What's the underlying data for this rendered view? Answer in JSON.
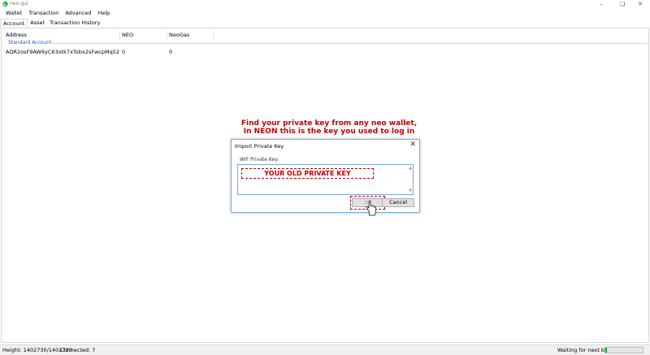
{
  "window": {
    "title": "neo-gui",
    "icon": "neo-logo-icon",
    "controls": [
      "minimize-icon",
      "maximize-icon",
      "close-icon"
    ]
  },
  "menu": [
    "Wallet",
    "Transaction",
    "Advanced",
    "Help"
  ],
  "tabs": [
    {
      "label": "Account",
      "active": true
    },
    {
      "label": "Asset",
      "active": false
    },
    {
      "label": "Transaction History",
      "active": false
    }
  ],
  "table": {
    "columns": [
      "Address",
      "NEO",
      "NeoGas"
    ],
    "group": "Standard Account",
    "rows": [
      {
        "address": "AQR2osF9AW6yC63otk7xTobx2sFwcpMq52",
        "neo": "0",
        "neogas": "0"
      }
    ]
  },
  "annotation": {
    "line1": "Find your private key from any neo wallet,",
    "line2": "In NEON this is the key you used to log in",
    "color": "#c00000"
  },
  "dialog": {
    "title": "Import Private Key",
    "field_label": "WIF Private Key:",
    "field_value": "YOUR OLD PRIVATE KEY",
    "ok_label": "OK",
    "cancel_label": "Cancel"
  },
  "status": {
    "height": "Height:  1402730/1402730",
    "connected": "Connected:  7",
    "waiting": "Waiting for next block:",
    "progress": 0.05
  },
  "colors": {
    "accent": "#1a5fb4",
    "annotation_red": "#c00000",
    "progress_green": "#06b025"
  }
}
